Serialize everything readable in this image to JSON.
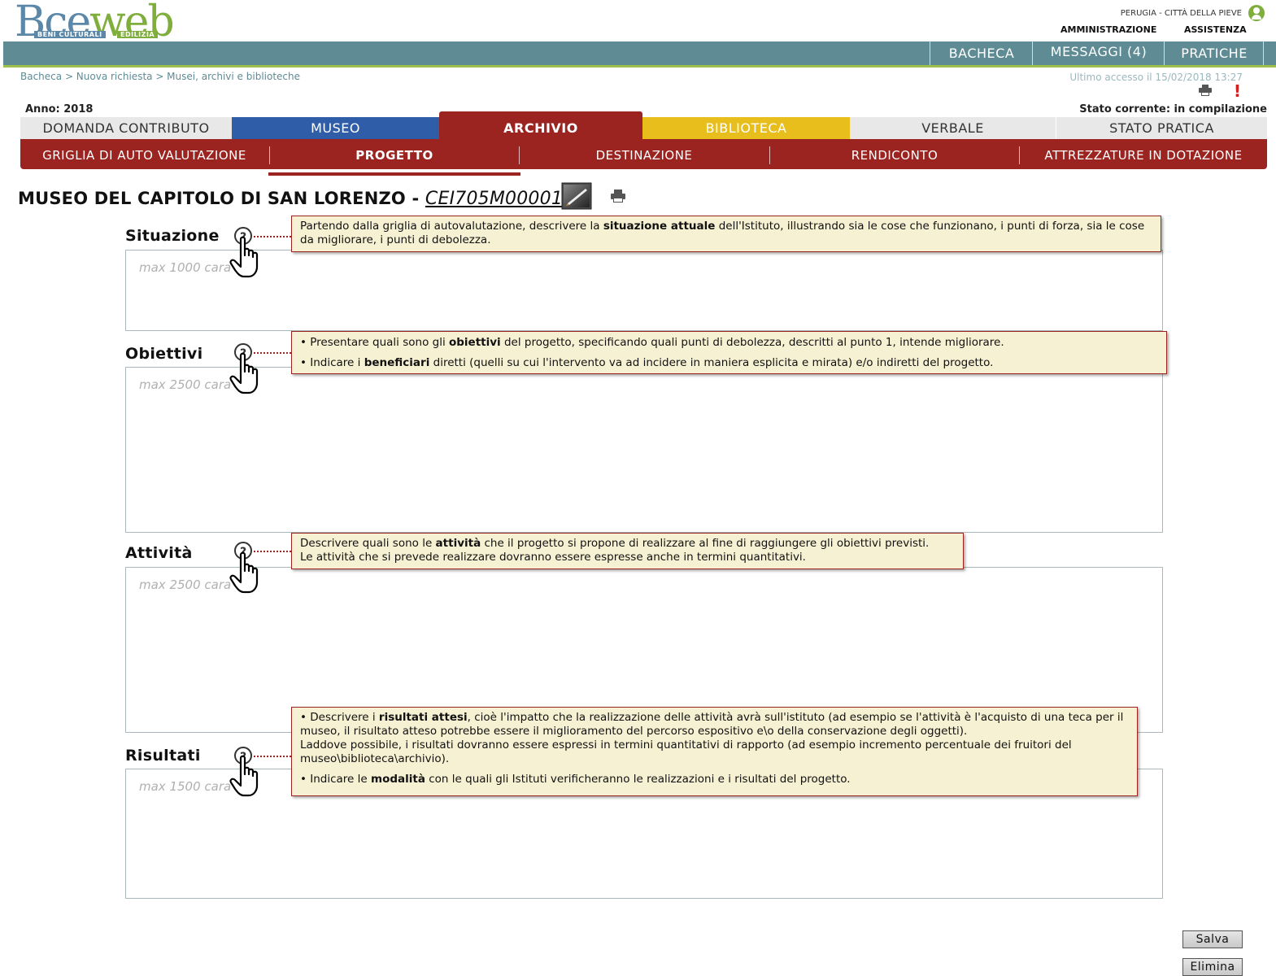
{
  "brand": {
    "logo_text_a": "Bce",
    "logo_text_b": "web",
    "sub1": "BENI CULTURALI",
    "sub2": "EDILIZIA"
  },
  "header": {
    "location": "PERUGIA - CITTÀ DELLA PIEVE",
    "admin": "AMMINISTRAZIONE",
    "assist": "ASSISTENZA"
  },
  "nav": {
    "bacheca": "BACHECA",
    "messaggi": "MESSAGGI (4)",
    "pratiche": "PRATICHE"
  },
  "breadcrumb": "Bacheca > Nuova richiesta > Musei, archivi e biblioteche",
  "last_access": "Ultimo accesso il 15/02/2018 13:27",
  "alert": "!",
  "year": "Anno: 2018",
  "status": "Stato corrente: in compilazione",
  "tabs": [
    {
      "label": "DOMANDA CONTRIBUTO",
      "bg": "#e8e8e8",
      "fg": "#333333"
    },
    {
      "label": "MUSEO",
      "bg": "#2f5da8",
      "fg": "#ffffff"
    },
    {
      "label": "ARCHIVIO",
      "bg": "#9b2320",
      "fg": "#ffffff"
    },
    {
      "label": "BIBLIOTECA",
      "bg": "#e8be1c",
      "fg": "#ffffff"
    },
    {
      "label": "VERBALE",
      "bg": "#e8e8e8",
      "fg": "#333333"
    },
    {
      "label": "STATO PRATICA",
      "bg": "#e8e8e8",
      "fg": "#333333"
    }
  ],
  "subtabs": [
    "GRIGLIA DI AUTO VALUTAZIONE",
    "PROGETTO",
    "DESTINAZIONE",
    "RENDICONTO",
    "ATTREZZATURE IN DOTAZIONE"
  ],
  "title": {
    "name": "MUSEO DEL CAPITOLO DI SAN LORENZO - ",
    "code": "CEI705M00001"
  },
  "fields": {
    "situazione": {
      "label": "Situazione",
      "help": "?",
      "placeholder": "max 1000 cara",
      "tip_parts": [
        "Partendo dalla griglia di autovalutazione, descrivere la ",
        "situazione attuale",
        " dell'Istituto, illustrando sia le cose che funzionano, i punti di forza, sia le cose da migliorare, i punti di debolezza."
      ]
    },
    "obiettivi": {
      "label": "Obiettivi",
      "help": "?",
      "placeholder": "max 2500 cara",
      "tip1_parts": [
        "• Presentare quali sono gli ",
        "obiettivi",
        " del progetto, specificando  quali punti di debolezza, descritti al punto 1, intende migliorare."
      ],
      "tip2_parts": [
        "• Indicare i ",
        "beneficiari",
        " diretti (quelli su cui l'intervento va ad incidere in maniera esplicita e mirata) e/o indiretti del progetto."
      ]
    },
    "attivita": {
      "label": "Attività",
      "help": "?",
      "placeholder": "max 2500 cara",
      "tip_parts": [
        "Descrivere quali sono le ",
        "attività",
        " che il progetto si propone di realizzare al fine di raggiungere gli obiettivi previsti.",
        "Le attività che si prevede realizzare dovranno essere espresse anche in termini quantitativi."
      ]
    },
    "risultati": {
      "label": "Risultati",
      "help": "?",
      "placeholder": "max 1500 cara",
      "tip1_parts": [
        "• Descrivere i ",
        "risultati attesi",
        ", cioè l'impatto che la realizzazione delle attività avrà sull'istituto (ad esempio se l'attività è l'acquisto di una teca per il museo, il risultato atteso potrebbe essere il miglioramento del percorso espositivo e\\o della conservazione degli oggetti).",
        "Laddove possibile, i risultati dovranno essere espressi in termini quantitativi di rapporto (ad esempio incremento percentuale dei fruitori del museo\\biblioteca\\archivio)."
      ],
      "tip2_parts": [
        "• Indicare le ",
        "modalità",
        " con le quali gli Istituti verificheranno le realizzazioni e i risultati del progetto."
      ]
    }
  },
  "buttons": {
    "save": "Salva",
    "delete": "Elimina"
  }
}
